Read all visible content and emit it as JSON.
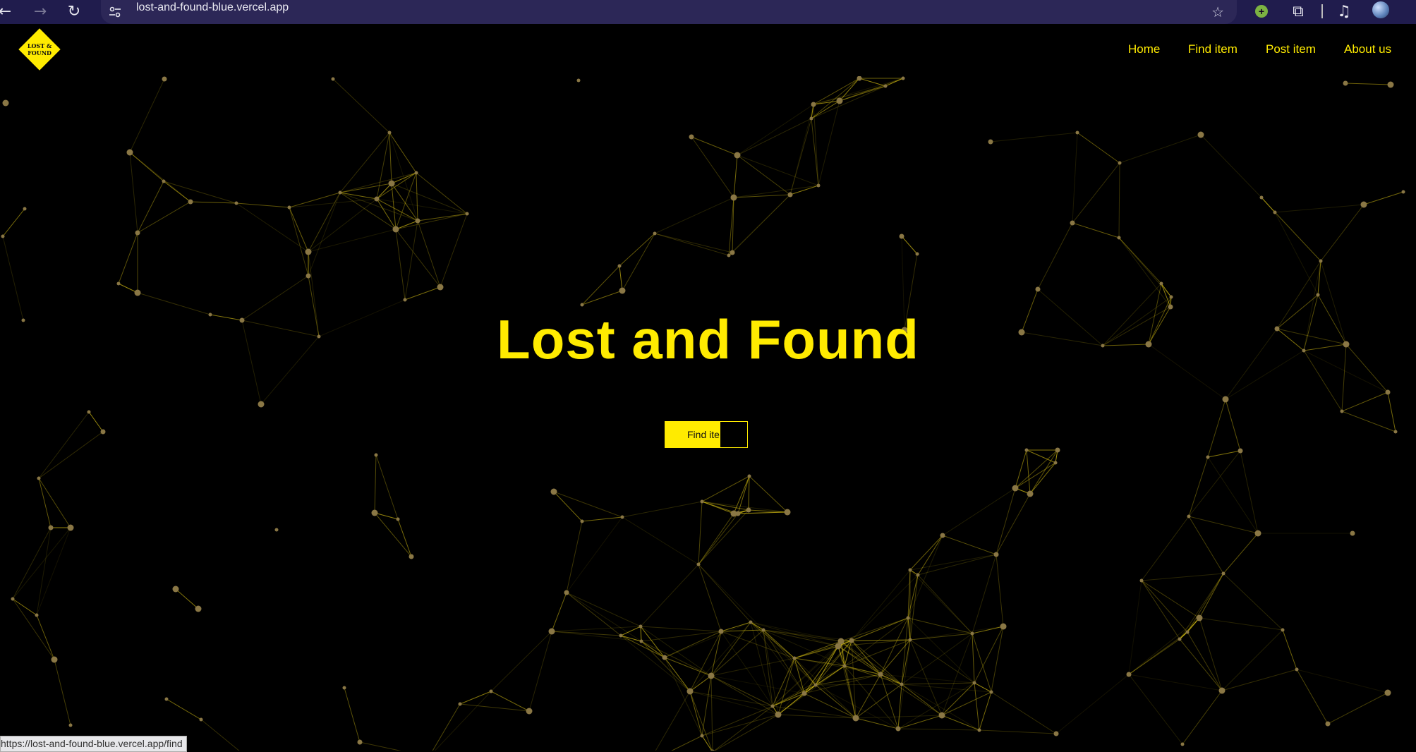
{
  "browser": {
    "url": "lost-and-found-blue.vercel.app",
    "icons": [
      "back-arrow-icon",
      "forward-arrow-icon",
      "reload-icon",
      "site-settings-icon",
      "bookmark-star-icon",
      "extension-icon",
      "puzzle-icon",
      "media-icon",
      "profile-avatar-icon"
    ],
    "status_url": "https://lost-and-found-blue.vercel.app/find"
  },
  "site": {
    "logo": {
      "line1": "LOST &",
      "line2": "FOUND"
    },
    "nav": [
      "Home",
      "Find item",
      "Post item",
      "About us"
    ],
    "hero_title": "Lost and Found",
    "hero_button": "Find item"
  },
  "colors": {
    "brand_yellow": "#ffeb00",
    "background": "#000000",
    "browser_bar": "#201c4d"
  }
}
